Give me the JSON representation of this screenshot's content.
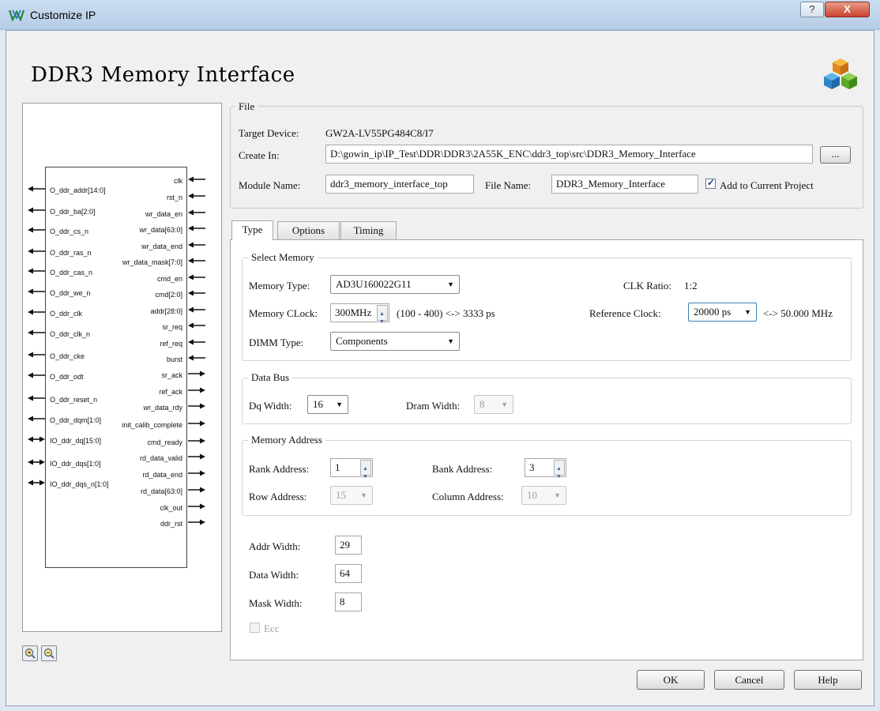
{
  "window": {
    "title": "Customize IP",
    "help_glyph": "?",
    "close_glyph": "X"
  },
  "heading": "DDR3 Memory Interface",
  "schematic": {
    "left_pins": [
      "O_ddr_addr[14:0]",
      "O_ddr_ba[2:0]",
      "O_ddr_cs_n",
      "O_ddr_ras_n",
      "O_ddr_cas_n",
      "O_ddr_we_n",
      "O_ddr_clk",
      "O_ddr_clk_n",
      "O_ddr_cke",
      "O_ddr_odt",
      "O_ddr_reset_n",
      "O_ddr_dqm[1:0]",
      "IO_ddr_dq[15:0]",
      "IO_ddr_dqs[1:0]",
      "IO_ddr_dqs_n[1:0]"
    ],
    "right_pins": [
      "clk",
      "rst_n",
      "wr_data_en",
      "wr_data[63:0]",
      "wr_data_end",
      "wr_data_mask[7:0]",
      "cmd_en",
      "cmd[2:0]",
      "addr[28:0]",
      "sr_req",
      "ref_req",
      "burst",
      "sr_ack",
      "ref_ack",
      "wr_data_rdy",
      "init_calib_complete",
      "cmd_ready",
      "rd_data_valid",
      "rd_data_end",
      "rd_data[63:0]",
      "clk_out",
      "ddr_rst"
    ]
  },
  "file": {
    "group_title": "File",
    "target_device_label": "Target Device:",
    "target_device": "GW2A-LV55PG484C8/I7",
    "create_in_label": "Create In:",
    "create_in": "D:\\gowin_ip\\IP_Test\\DDR\\DDR3\\2A55K_ENC\\ddr3_top\\src\\DDR3_Memory_Interface",
    "browse_label": "...",
    "module_name_label": "Module Name:",
    "module_name": "ddr3_memory_interface_top",
    "file_name_label": "File Name:",
    "file_name": "DDR3_Memory_Interface",
    "add_to_project_label": "Add to Current Project"
  },
  "tabs": [
    "Type",
    "Options",
    "Timing"
  ],
  "select_memory": {
    "title": "Select Memory",
    "memory_type_label": "Memory Type:",
    "memory_type": "AD3U160022G11",
    "clk_ratio_label": "CLK Ratio:",
    "clk_ratio": "1:2",
    "memory_clock_label": "Memory CLock:",
    "memory_clock": "300MHz",
    "memory_clock_range": "(100 - 400) <-> 3333 ps",
    "reference_clock_label": "Reference Clock:",
    "reference_clock": "20000 ps",
    "reference_clock_mhz": "<-> 50.000 MHz",
    "dimm_type_label": "DIMM Type:",
    "dimm_type": "Components"
  },
  "data_bus": {
    "title": "Data Bus",
    "dq_width_label": "Dq Width:",
    "dq_width": "16",
    "dram_width_label": "Dram Width:",
    "dram_width": "8"
  },
  "memory_address": {
    "title": "Memory Address",
    "rank_address_label": "Rank Address:",
    "rank_address": "1",
    "bank_address_label": "Bank Address:",
    "bank_address": "3",
    "row_address_label": "Row Address:",
    "row_address": "15",
    "column_address_label": "Column Address:",
    "column_address": "10"
  },
  "widths": {
    "addr_width_label": "Addr Width:",
    "addr_width": "29",
    "data_width_label": "Data Width:",
    "data_width": "64",
    "mask_width_label": "Mask Width:",
    "mask_width": "8",
    "ecc_label": "Ecc"
  },
  "buttons": {
    "ok": "OK",
    "cancel": "Cancel",
    "help": "Help"
  }
}
